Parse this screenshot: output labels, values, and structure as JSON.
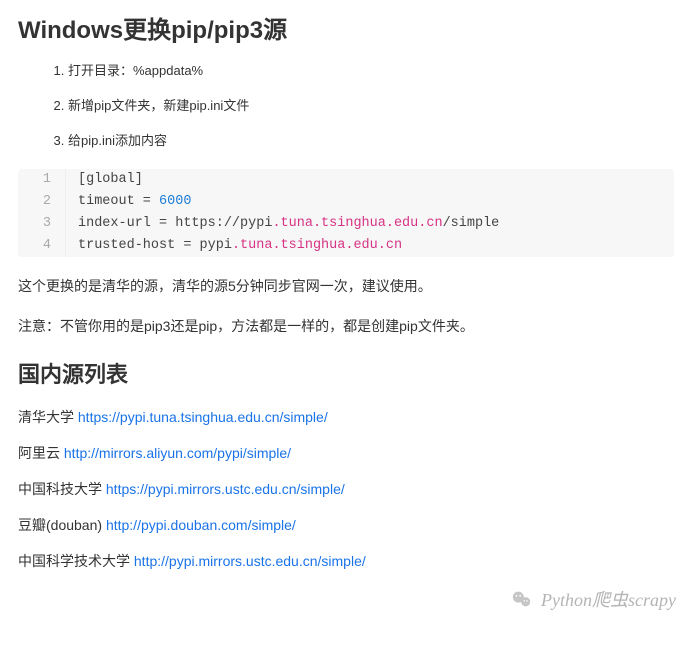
{
  "heading1": "Windows更换pip/pip3源",
  "steps": [
    "打开目录：%appdata%",
    "新增pip文件夹，新建pip.ini文件",
    "给pip.ini添加内容"
  ],
  "code": {
    "line1": "[global]",
    "line2_pre": "timeout = ",
    "line2_num": "6000",
    "line3_pre": "index-url = https://pypi",
    "line3_dom": ".tuna.tsinghua.edu.cn",
    "line3_post": "/simple",
    "line4_pre": "trusted-host = pypi",
    "line4_dom": ".tuna.tsinghua.edu.cn",
    "lineno1": "1",
    "lineno2": "2",
    "lineno3": "3",
    "lineno4": "4"
  },
  "para1": "这个更换的是清华的源，清华的源5分钟同步官网一次，建议使用。",
  "para2": "注意：不管你用的是pip3还是pip，方法都是一样的，都是创建pip文件夹。",
  "heading2": "国内源列表",
  "mirrors": [
    {
      "name": "清华大学 ",
      "url": "https://pypi.tuna.tsinghua.edu.cn/simple/"
    },
    {
      "name": "阿里云 ",
      "url": "http://mirrors.aliyun.com/pypi/simple/"
    },
    {
      "name": "中国科技大学 ",
      "url": "https://pypi.mirrors.ustc.edu.cn/simple/"
    },
    {
      "name": "豆瓣(douban) ",
      "url": "http://pypi.douban.com/simple/"
    },
    {
      "name": "中国科学技术大学 ",
      "url": "http://pypi.mirrors.ustc.edu.cn/simple/"
    }
  ],
  "watermark": "Python爬虫scrapy"
}
